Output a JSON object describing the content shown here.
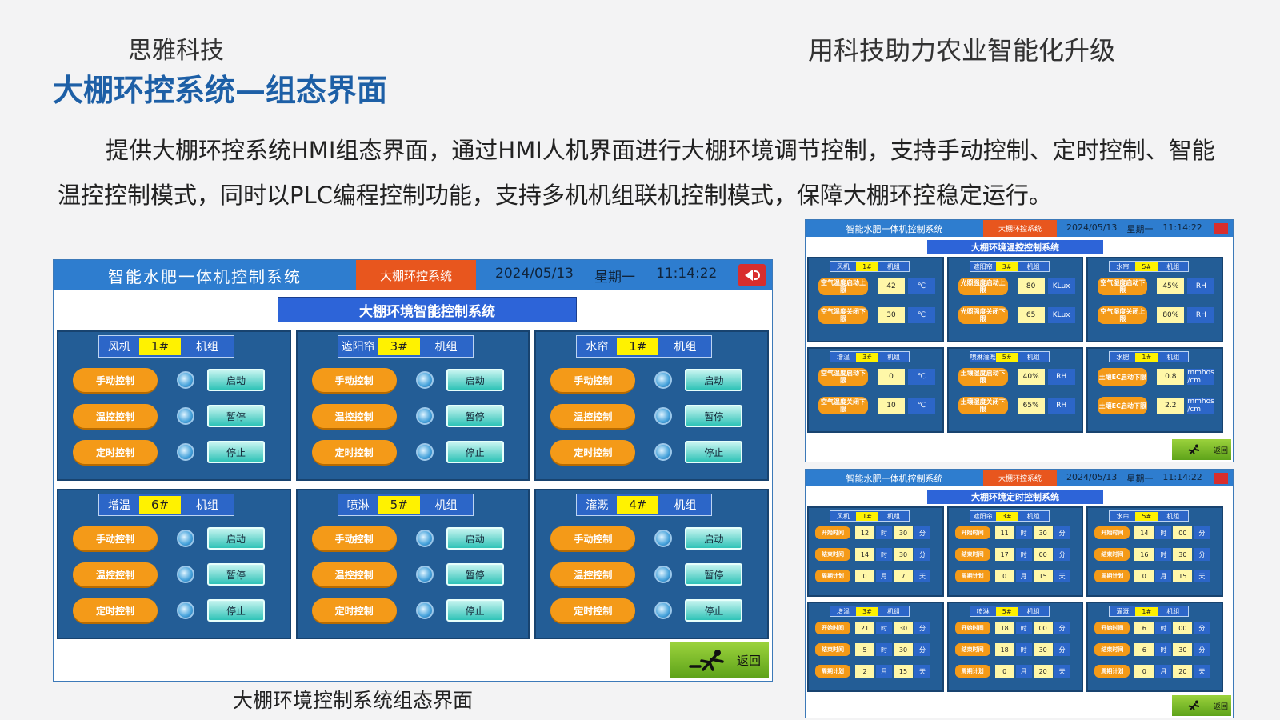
{
  "header": {
    "brand": "思雅科技",
    "slogan": "用科技助力农业智能化升级",
    "title": "大棚环控系统—组态界面"
  },
  "description": "提供大棚环控系统HMI组态界面，通过HMI人机界面进行大棚环境调节控制，支持手动控制、定时控制、智能温控控制模式，同时以PLC编程控制功能，支持多机机组联机控制模式，保障大棚环控稳定运行。",
  "caption": "大棚环境控制系统组态界面",
  "hmi": {
    "system_name": "智能水肥一体机控制系统",
    "active_tab": "大棚环控系统",
    "date": "2024/05/13",
    "weekday": "星期一",
    "time": "11:14:22",
    "subtitle": "大棚环境智能控制系统",
    "unit_suffix": "机组",
    "buttons": {
      "manual": "手动控制",
      "temp": "温控控制",
      "timer": "定时控制",
      "start": "启动",
      "pause": "暂停",
      "stop": "停止"
    },
    "back": "返回",
    "panels": [
      {
        "name": "风机",
        "no": "1#"
      },
      {
        "name": "遮阳帘",
        "no": "3#"
      },
      {
        "name": "水帘",
        "no": "1#"
      },
      {
        "name": "增温",
        "no": "6#"
      },
      {
        "name": "喷淋",
        "no": "5#"
      },
      {
        "name": "灌溉",
        "no": "4#"
      }
    ],
    "colors": {
      "titlebar": "#2e7dcf",
      "active_tab": "#e8561e",
      "panel": "#235d96",
      "orange_button": "#f49a18",
      "unit_yellow": "#fff200"
    }
  },
  "mini_temp": {
    "system_name": "智能水肥一体机控制系统",
    "active_tab": "大棚环控系统",
    "date": "2024/05/13",
    "weekday": "星期一",
    "time": "11:14:22",
    "subtitle": "大棚环境温控控制系统",
    "unit_suffix": "机组",
    "back": "返回",
    "panels": [
      {
        "name": "风机",
        "no": "1#",
        "rows": [
          {
            "label": "空气温度启动上限",
            "value": "42",
            "unit": "℃"
          },
          {
            "label": "空气温度关闭下限",
            "value": "30",
            "unit": "℃"
          }
        ]
      },
      {
        "name": "遮阳帘",
        "no": "3#",
        "rows": [
          {
            "label": "光照强度启动上限",
            "value": "80",
            "unit": "KLux"
          },
          {
            "label": "光照强度关闭下限",
            "value": "65",
            "unit": "KLux"
          }
        ]
      },
      {
        "name": "水帘",
        "no": "5#",
        "rows": [
          {
            "label": "空气湿度启动下限",
            "value": "45%",
            "unit": "RH"
          },
          {
            "label": "空气湿度关闭上限",
            "value": "80%",
            "unit": "RH"
          }
        ]
      },
      {
        "name": "增温",
        "no": "3#",
        "rows": [
          {
            "label": "空气温度启动下限",
            "value": "0",
            "unit": "℃"
          },
          {
            "label": "空气温度关闭下限",
            "value": "10",
            "unit": "℃"
          }
        ]
      },
      {
        "name": "喷淋灌溉",
        "no": "5#",
        "rows": [
          {
            "label": "土壤湿度启动下限",
            "value": "40%",
            "unit": "RH"
          },
          {
            "label": "土壤湿度关闭下限",
            "value": "65%",
            "unit": "RH"
          }
        ]
      },
      {
        "name": "水肥",
        "no": "1#",
        "rows": [
          {
            "label": "土壤EC启动下限",
            "value": "0.8",
            "unit": "mmhos /cm"
          },
          {
            "label": "土壤EC启动下限",
            "value": "2.2",
            "unit": "mmhos /cm"
          }
        ]
      }
    ]
  },
  "mini_timer": {
    "system_name": "智能水肥一体机控制系统",
    "active_tab": "大棚环控系统",
    "date": "2024/05/13",
    "weekday": "星期一",
    "time": "11:14:22",
    "subtitle": "大棚环境定时控制系统",
    "unit_suffix": "机组",
    "back": "返回",
    "labels": {
      "start": "开始时间",
      "end": "结束时间",
      "plan": "周期计划"
    },
    "units": {
      "hour": "时",
      "minute": "分",
      "month": "月",
      "day": "天"
    },
    "panels": [
      {
        "name": "风机",
        "no": "1#",
        "start": [
          "12",
          "30"
        ],
        "end": [
          "14",
          "30"
        ],
        "plan": [
          "0",
          "7"
        ]
      },
      {
        "name": "遮阳帘",
        "no": "3#",
        "start": [
          "11",
          "30"
        ],
        "end": [
          "17",
          "00"
        ],
        "plan": [
          "0",
          "15"
        ]
      },
      {
        "name": "水帘",
        "no": "5#",
        "start": [
          "14",
          "00"
        ],
        "end": [
          "16",
          "30"
        ],
        "plan": [
          "0",
          "15"
        ]
      },
      {
        "name": "增温",
        "no": "3#",
        "start": [
          "21",
          "30"
        ],
        "end": [
          "5",
          "30"
        ],
        "plan": [
          "2",
          "15"
        ]
      },
      {
        "name": "喷淋",
        "no": "5#",
        "start": [
          "18",
          "00"
        ],
        "end": [
          "18",
          "30"
        ],
        "plan": [
          "0",
          "20"
        ]
      },
      {
        "name": "灌溉",
        "no": "1#",
        "start": [
          "6",
          "00"
        ],
        "end": [
          "6",
          "30"
        ],
        "plan": [
          "0",
          "20"
        ]
      }
    ]
  }
}
